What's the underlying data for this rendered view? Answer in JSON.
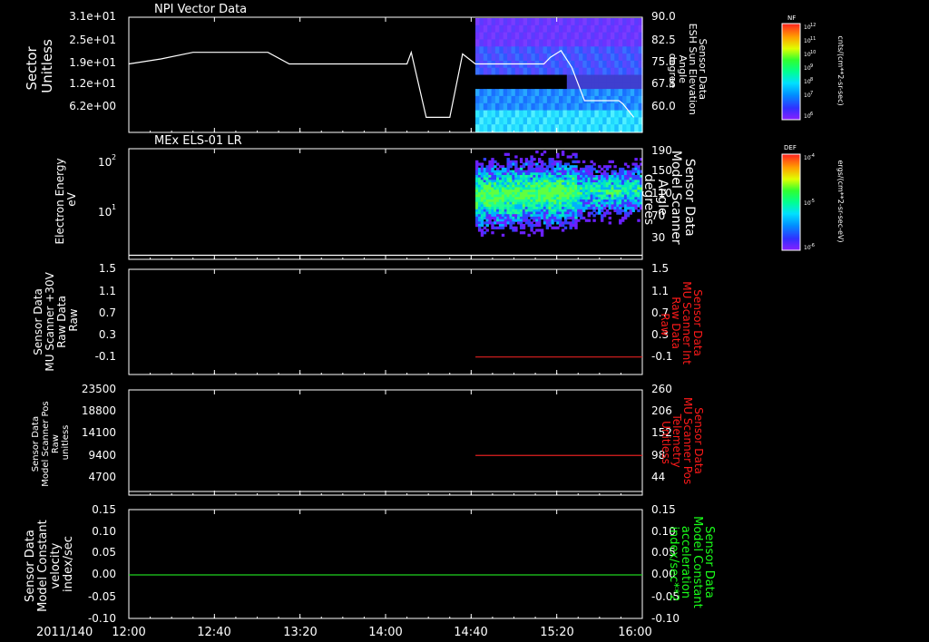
{
  "date_label": "2011/140",
  "x_ticks": [
    "12:00",
    "12:40",
    "13:20",
    "14:00",
    "14:40",
    "15:20",
    "16:00"
  ],
  "colors": {
    "background": "#000000",
    "axis": "#ffffff",
    "red_label": "#ff1a1a",
    "green_label": "#1aff1a",
    "red_line": "#e02020",
    "green_line": "#1fd11f"
  },
  "panels": [
    {
      "title": "NPI Vector Data",
      "left_label": [
        "Sector",
        "Unitless"
      ],
      "left_ticks": [
        "3.1e+01",
        "2.5e+01",
        "1.9e+01",
        "1.2e+01",
        "6.2e+00"
      ],
      "right_label": [
        "Sensor Data",
        "ESH Sun Elevation",
        "Angle",
        "degree"
      ],
      "right_ticks": [
        "90.0",
        "82.5",
        "75.0",
        "67.5",
        "60.0"
      ],
      "right_label_color": "white"
    },
    {
      "title": "MEx ELS-01 LR",
      "left_label": [
        "Electron Energy",
        "eV"
      ],
      "left_ticks": [
        "10",
        "2",
        "10",
        "1"
      ],
      "right_label": [
        "Sensor Data",
        "Model Scanner",
        "Angle",
        "degrees"
      ],
      "right_ticks": [
        "190",
        "150",
        "110",
        "70",
        "30"
      ],
      "right_label_color": "white"
    },
    {
      "title": "",
      "left_label": [
        "Sensor Data",
        "MU Scanner +30V",
        "Raw Data",
        "Raw"
      ],
      "left_ticks": [
        "1.5",
        "1.1",
        "0.7",
        "0.3",
        "-0.1"
      ],
      "right_label": [
        "Sensor Data",
        "MU Scanner Int",
        "Raw Data",
        "Raw"
      ],
      "right_ticks": [
        "1.5",
        "1.1",
        "0.7",
        "0.3",
        "-0.1"
      ],
      "right_label_color": "red"
    },
    {
      "title": "",
      "left_label": [
        "Sensor Data",
        "Model Scanner Pos",
        "Raw",
        "unitless"
      ],
      "left_ticks": [
        "23500",
        "18800",
        "14100",
        "9400",
        "4700"
      ],
      "right_label": [
        "Sensor Data",
        "MU Scanner Pos",
        "Telemetry",
        "Unitless"
      ],
      "right_ticks": [
        "260",
        "206",
        "152",
        "98",
        "44"
      ],
      "right_label_color": "red"
    },
    {
      "title": "",
      "left_label": [
        "Sensor Data",
        "Model Constant",
        "velocity",
        "index/sec"
      ],
      "left_ticks": [
        "0.15",
        "0.10",
        "0.05",
        "0.00",
        "-0.05",
        "-0.10"
      ],
      "right_label": [
        "Sensor Data",
        "Model Constant",
        "acceleration",
        "index/sec**2"
      ],
      "right_ticks": [
        "0.15",
        "0.10",
        "0.05",
        "0.00",
        "-0.05",
        "-0.10"
      ],
      "right_label_color": "green"
    }
  ],
  "colorbars": [
    {
      "label": "NF",
      "units": "cnts/(cm**2-sr-sec)",
      "ticks": [
        "10",
        "12",
        "10",
        "11",
        "10",
        "10",
        "10",
        "9",
        "10",
        "8",
        "10",
        "7",
        "10",
        "6"
      ]
    },
    {
      "label": "DEF",
      "units": "ergs/(cm**2-sr-sec-eV)",
      "ticks": [
        "10",
        "-4",
        "10",
        "-5",
        "10",
        "-6"
      ]
    }
  ],
  "chart_data": [
    {
      "type": "heatmap",
      "title": "NPI Vector Data",
      "ylabel": "Sector Unitless",
      "x_range": [
        "12:00",
        "16:00"
      ],
      "data_start": "14:42",
      "overlay_line": {
        "name": "Sensor Data ESH Sun Elevation Angle",
        "units": "degree",
        "ylim": [
          55.5,
          90.0
        ],
        "x": [
          "12:00",
          "12:15",
          "12:30",
          "13:05",
          "13:15",
          "14:10",
          "14:12",
          "14:19",
          "14:30",
          "14:36",
          "14:42",
          "15:14",
          "15:17",
          "15:22",
          "15:27",
          "15:33",
          "15:49",
          "15:51",
          "15:56"
        ],
        "y": [
          76.0,
          77.5,
          79.5,
          79.5,
          76.0,
          76.0,
          79.5,
          60.0,
          60.0,
          79.0,
          76.0,
          76.0,
          78.0,
          80.0,
          75.0,
          65.0,
          65.0,
          64.0,
          60.0
        ]
      }
    },
    {
      "type": "heatmap",
      "title": "MEx ELS-01 LR",
      "ylabel": "Electron Energy eV",
      "yscale": "log",
      "x_range": [
        "12:00",
        "16:00"
      ],
      "data_start": "14:42",
      "overlay_line": {
        "name": "Sensor Data Model Scanner Angle",
        "units": "degrees",
        "ylim": [
          0,
          190
        ],
        "x": [
          "12:00",
          "16:00"
        ],
        "y": [
          7,
          7
        ]
      }
    },
    {
      "type": "line",
      "ylabel": "Sensor Data MU Scanner +30V Raw Data Raw",
      "ylim": [
        -0.3,
        1.5
      ],
      "series": [
        {
          "name": "Sensor Data MU Scanner Int Raw Data Raw",
          "color": "#e02020",
          "x": [
            "14:42",
            "16:00"
          ],
          "y": [
            0.0,
            0.0
          ]
        }
      ]
    },
    {
      "type": "line",
      "ylabel": "Sensor Data Model Scanner Pos Raw unitless",
      "right_ylim": [
        0,
        260
      ],
      "series": [
        {
          "name": "Sensor Data MU Scanner Pos Telemetry Unitless",
          "color": "#e02020",
          "x": [
            "14:42",
            "16:00"
          ],
          "y": [
            98,
            98
          ]
        }
      ]
    },
    {
      "type": "line",
      "ylabel": "Sensor Data Model Constant velocity index/sec",
      "ylim": [
        -0.1,
        0.15
      ],
      "series": [
        {
          "name": "Sensor Data Model Constant acceleration index/sec**2",
          "color": "#1fd11f",
          "x": [
            "12:00",
            "16:00"
          ],
          "y": [
            0.0,
            0.0
          ]
        }
      ]
    }
  ]
}
